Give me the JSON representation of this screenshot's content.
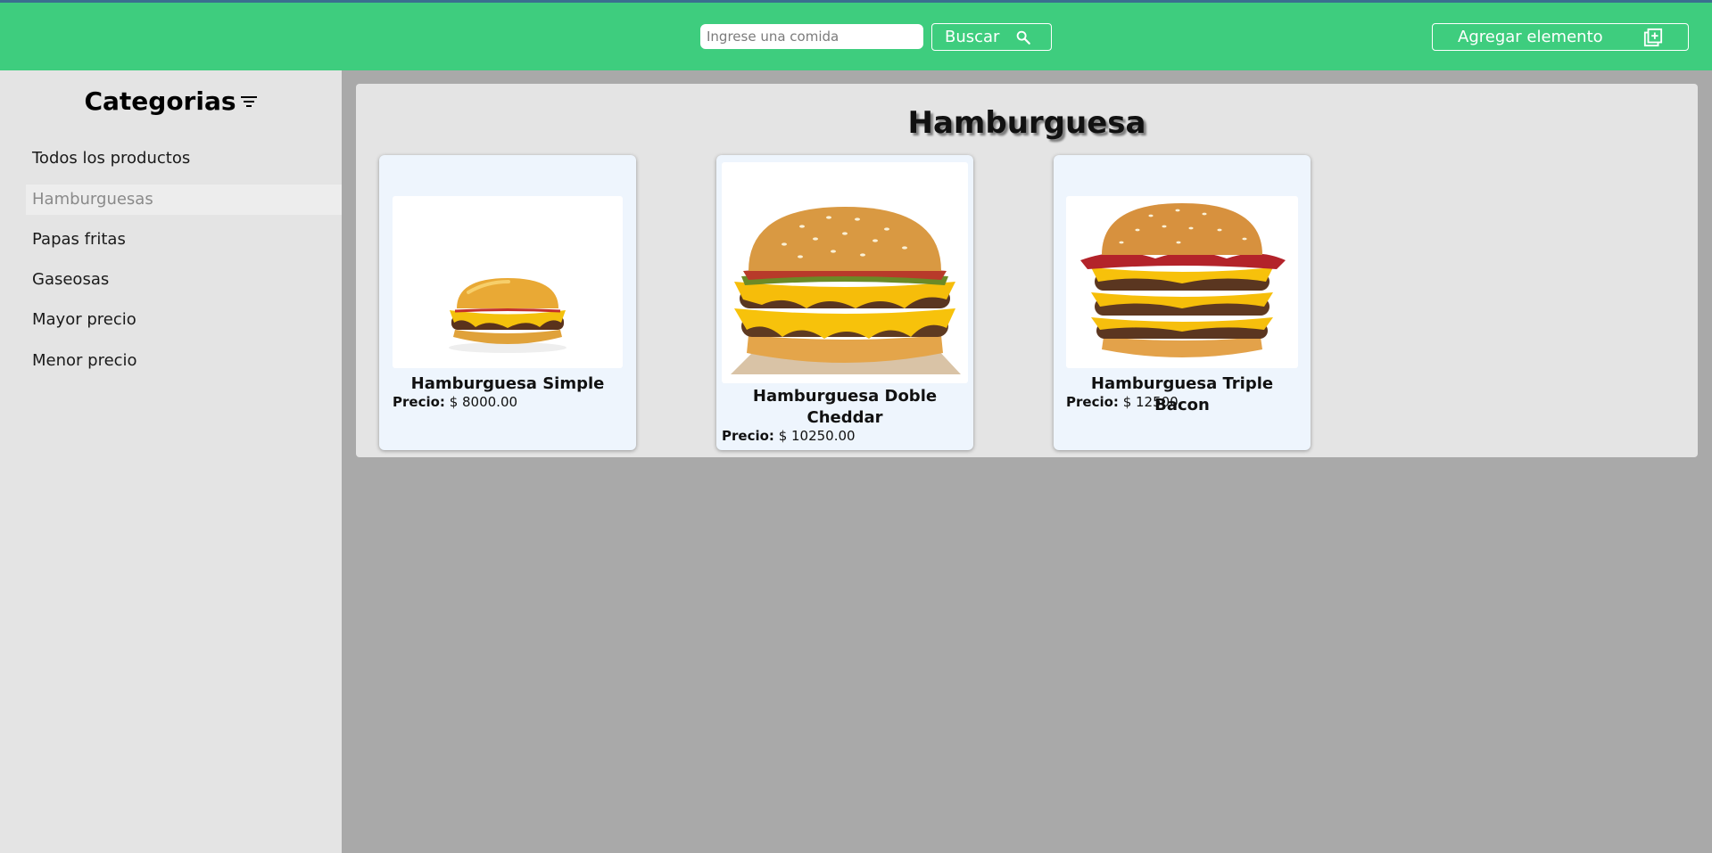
{
  "header": {
    "search_placeholder": "Ingrese una comida",
    "search_button": "Buscar",
    "add_button": "Agregar elemento"
  },
  "sidebar": {
    "title": "Categorias",
    "items": [
      {
        "label": "Todos los productos",
        "active": false
      },
      {
        "label": "Hamburguesas",
        "active": true
      },
      {
        "label": "Papas fritas",
        "active": false
      },
      {
        "label": "Gaseosas",
        "active": false
      },
      {
        "label": "Mayor precio",
        "active": false
      },
      {
        "label": "Menor precio",
        "active": false
      }
    ]
  },
  "main": {
    "title": "Hamburguesa",
    "products": [
      {
        "name": "Hamburguesa Simple",
        "price_label": "Precio:",
        "price": "$ 8000.00"
      },
      {
        "name": "Hamburguesa Doble Cheddar",
        "price_label": "Precio:",
        "price": "$ 10250.00"
      },
      {
        "name": "Hamburguesa Triple Bacon",
        "price_label": "Precio:",
        "price": "$ 12500"
      }
    ]
  },
  "colors": {
    "header_bg": "#3ecd7e",
    "sidebar_bg": "#e4e4e4",
    "page_bg": "#a9a9a9",
    "card_bg": "#eef5fd"
  }
}
